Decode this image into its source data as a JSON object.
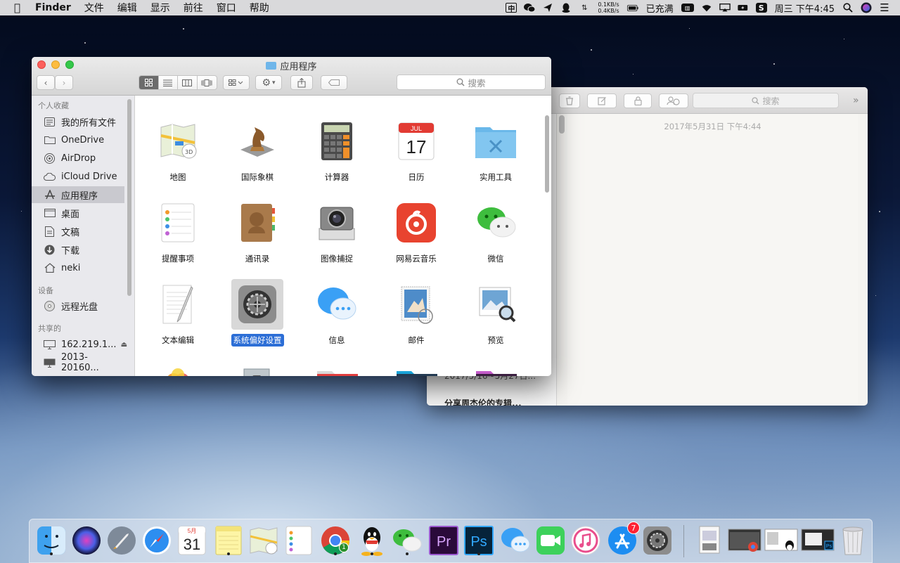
{
  "menubar": {
    "app_name": "Finder",
    "menus": [
      "文件",
      "编辑",
      "显示",
      "前往",
      "窗口",
      "帮助"
    ],
    "input_method": "中",
    "net_up": "0.1KB/s",
    "net_down": "0.4KB/s",
    "battery_status": "已充满",
    "clock": "周三 下午4:45"
  },
  "finder": {
    "title": "应用程序",
    "search_placeholder": "搜索",
    "sidebar": {
      "favorites_header": "个人收藏",
      "favorites": [
        "我的所有文件",
        "OneDrive",
        "AirDrop",
        "iCloud Drive",
        "应用程序",
        "桌面",
        "文稿",
        "下载",
        "neki"
      ],
      "devices_header": "设备",
      "devices": [
        "远程光盘"
      ],
      "shared_header": "共享的",
      "shared": [
        "162.219.1...",
        "2013-20160..."
      ]
    },
    "apps": [
      "地图",
      "国际象棋",
      "计算器",
      "日历",
      "实用工具",
      "提醒事项",
      "通讯录",
      "图像捕捉",
      "网易云音乐",
      "微信",
      "文本编辑",
      "系统偏好设置",
      "信息",
      "邮件",
      "预览"
    ],
    "selected_app": "系统偏好设置",
    "calendar_month": "JUL",
    "calendar_day": "17"
  },
  "notes": {
    "search_placeholder": "搜索",
    "note_date": "2017年5月31日 下午4:44",
    "list_partial_1": "2017/5/16~5月27日...",
    "list_partial_2": "分享周杰伦的专辑..."
  },
  "dock": {
    "calendar_month": "5月",
    "calendar_day": "31",
    "appstore_badge": "7",
    "chrome_badge": "1"
  }
}
